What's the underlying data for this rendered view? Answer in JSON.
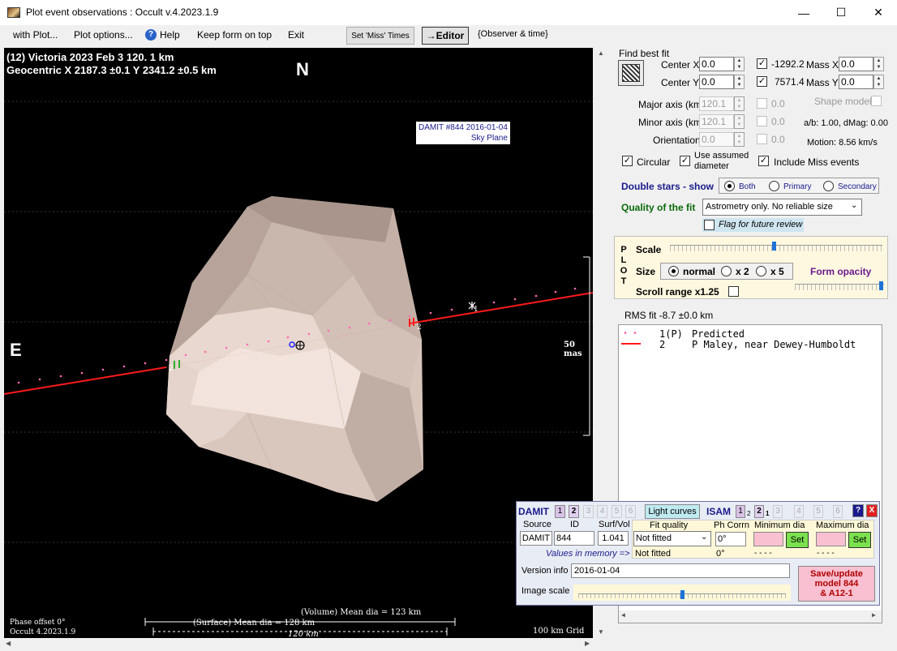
{
  "window": {
    "title": "Plot event observations : Occult v.4.2023.1.9",
    "controls": [
      "—",
      "☐",
      "✕"
    ]
  },
  "menu": {
    "items": [
      "with Plot...",
      "Plot options...",
      "Help",
      "Keep form on top",
      "Exit"
    ],
    "set_miss_times": "Set 'Miss' Times",
    "editor": "→Editor",
    "observer_time": "{Observer & time}"
  },
  "plot": {
    "header_line1": "(12) Victoria  2023 Feb 3   120. 1 km",
    "header_line2": "Geocentric  X  2187.3 ±0.1  Y 2341.2 ±0.5 km",
    "north": "N",
    "east": "E",
    "damit_label_1": "DAMIT #844 2016-01-04",
    "damit_label_2": "Sky Plane",
    "scale_label": "50 mas",
    "phase_offset": "Phase offset 0°",
    "occult_version": "Occult 4.2023.1.9",
    "volume_dia": "(Volume) Mean dia = 123 km",
    "surface_dia": "(Surface) Mean dia = 128 km",
    "km_label": "120 km",
    "grid_label": "100 km Grid",
    "chord_label_1": "1",
    "chord_label_2": "2"
  },
  "fit": {
    "find_best_fit": "Find best fit",
    "center_x_label": "Center X",
    "center_x": "0.0",
    "center_y_label": "Center Y",
    "center_y": "0.0",
    "x_value": "-1292.2",
    "y_value": "7571.4",
    "mass_x_label": "Mass X",
    "mass_x": "0.0",
    "mass_y_label": "Mass Y",
    "mass_y": "0.0",
    "major_axis_label": "Major axis (km)",
    "major_axis": "120.1",
    "minor_axis_label": "Minor axis (km)",
    "minor_axis": "120.1",
    "orientation_label": "Orientation",
    "orientation": "0.0",
    "major_fit": "0.0",
    "minor_fit": "0.0",
    "orient_fit": "0.0",
    "shape_model": "Shape model",
    "ab_dmag": "a/b: 1.00, dMag: 0.00",
    "motion": "Motion: 8.56 km/s",
    "circular": "Circular",
    "use_assumed": "Use assumed",
    "diameter": "diameter",
    "include_miss": "Include Miss events",
    "double_stars": "Double stars - show",
    "both": "Both",
    "primary": "Primary",
    "secondary": "Secondary",
    "quality_label": "Quality of the fit",
    "quality_value": "Astrometry only. No reliable size",
    "flag_review": "Flag for future review"
  },
  "plotpanel": {
    "letters": [
      "P",
      "L",
      "O",
      "T"
    ],
    "scale": "Scale",
    "size": "Size",
    "normal": "normal",
    "x2": "x 2",
    "x5": "x 5",
    "form_opacity": "Form opacity",
    "scroll_range": "Scroll range x1.25",
    "scale_slider": 0.49,
    "opacity_slider": 0.98
  },
  "rms": "RMS fit -8.7 ±0.0 km",
  "legend": [
    {
      "num": "1(P)",
      "text": "Predicted",
      "color": "#ff69b4"
    },
    {
      "num": "2",
      "text": "P Maley, near Dewey-Humboldt",
      "color": "#ff0000"
    }
  ],
  "damit": {
    "title": "DAMIT",
    "tabs": [
      "1",
      "2",
      "3",
      "4",
      "5",
      "6"
    ],
    "light_curves": "Light curves",
    "isam": "ISAM",
    "isam_tabs": [
      "1",
      "2",
      "2",
      "3",
      "4",
      "5",
      "6"
    ],
    "isam_subs": [
      "2",
      "1"
    ],
    "help": "?",
    "close": "X",
    "source_label": "Source",
    "id_label": "ID",
    "surf_label": "Surf/Vol",
    "source": "DAMIT",
    "id": "844",
    "surf": "1.041",
    "values_memory": "Values in memory =>",
    "fit_quality_label": "Fit quality",
    "fit_quality": "Not fitted",
    "fit_quality_mem": "Not fitted",
    "ph_corr_label": "Ph Corrn",
    "ph_corr": "0°",
    "ph_corr_mem": "0°",
    "min_dia_label": "Minimum dia",
    "max_dia_label": "Maximum dia",
    "set": "Set",
    "min_dash": "- - - -",
    "max_dash": "- - - -",
    "version_label": "Version info",
    "version": "2016-01-04",
    "image_scale": "Image scale",
    "image_scale_slider": 0.5,
    "save_line1": "Save/update",
    "save_line2": "model 844",
    "save_line3": "& A12-1"
  }
}
